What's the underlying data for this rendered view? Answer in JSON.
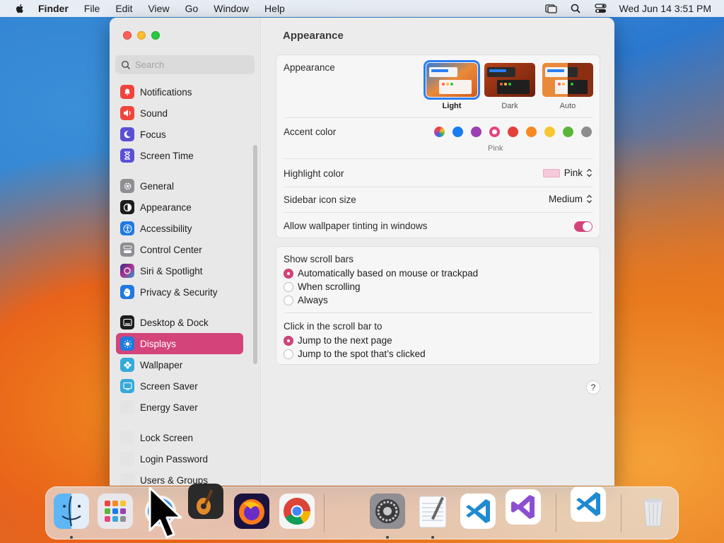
{
  "menubar": {
    "app_name": "Finder",
    "items": [
      "File",
      "Edit",
      "View",
      "Go",
      "Window",
      "Help"
    ],
    "clock": "Wed Jun 14  3:51 PM"
  },
  "window": {
    "search_placeholder": "Search",
    "sidebar": {
      "items": [
        {
          "label": "Notifications",
          "icon": "bell-icon",
          "color": "#f0443c"
        },
        {
          "label": "Sound",
          "icon": "speaker-icon",
          "color": "#f0443c"
        },
        {
          "label": "Focus",
          "icon": "moon-icon",
          "color": "#5b4fd6"
        },
        {
          "label": "Screen Time",
          "icon": "hourglass-icon",
          "color": "#5b4fd6"
        },
        {
          "label": "General",
          "icon": "gear-icon",
          "color": "#8e8e93"
        },
        {
          "label": "Appearance",
          "icon": "appearance-icon",
          "color": "#1d1d1f"
        },
        {
          "label": "Accessibility",
          "icon": "accessibility-icon",
          "color": "#1f7ae0"
        },
        {
          "label": "Control Center",
          "icon": "control-center-icon",
          "color": "#8e8e93"
        },
        {
          "label": "Siri & Spotlight",
          "icon": "siri-icon",
          "color": "#b0308f"
        },
        {
          "label": "Privacy & Security",
          "icon": "hand-icon",
          "color": "#1f7ae0"
        },
        {
          "label": "Desktop & Dock",
          "icon": "desktop-dock-icon",
          "color": "#1d1d1f"
        },
        {
          "label": "Displays",
          "icon": "sun-icon",
          "color": "#1f7ae0"
        },
        {
          "label": "Wallpaper",
          "icon": "wallpaper-icon",
          "color": "#34aadc"
        },
        {
          "label": "Screen Saver",
          "icon": "screen-saver-icon",
          "color": "#34aadc"
        },
        {
          "label": "Energy Saver",
          "icon": "energy-saver-icon",
          "color": "#e4e4e4"
        },
        {
          "label": "Lock Screen",
          "icon": "lock-screen-icon",
          "color": "#e4e4e4"
        },
        {
          "label": "Login Password",
          "icon": "login-password-icon",
          "color": "#e4e4e4"
        },
        {
          "label": "Users & Groups",
          "icon": "users-groups-icon",
          "color": "#e4e4e4"
        }
      ],
      "selected": "Displays"
    },
    "pane": {
      "title": "Appearance",
      "appearance": {
        "label": "Appearance",
        "options": [
          "Light",
          "Dark",
          "Auto"
        ],
        "selected": "Light"
      },
      "accent": {
        "label": "Accent color",
        "colors": [
          "multicolor",
          "#1a7bf2",
          "#9b3fb4",
          "#e8417d",
          "#e3403b",
          "#f58a24",
          "#f7c630",
          "#5ab639",
          "#8d8d8d"
        ],
        "selected_index": 3,
        "selected_name": "Pink"
      },
      "highlight": {
        "label": "Highlight color",
        "value": "Pink"
      },
      "sidebar_icon_size": {
        "label": "Sidebar icon size",
        "value": "Medium"
      },
      "wallpaper_tinting": {
        "label": "Allow wallpaper tinting in windows",
        "on": true
      },
      "scroll_bars": {
        "label": "Show scroll bars",
        "options": [
          "Automatically based on mouse or trackpad",
          "When scrolling",
          "Always"
        ],
        "selected_index": 0
      },
      "click_scroll": {
        "label": "Click in the scroll bar to",
        "options": [
          "Jump to the next page",
          "Jump to the spot that’s clicked"
        ],
        "selected_index": 0
      },
      "help": "?"
    }
  },
  "dock": {
    "apps": [
      "finder-icon",
      "launchpad-icon",
      "safari-icon",
      "garageband-icon",
      "firefox-icon",
      "chrome-icon",
      "system-settings-icon",
      "textedit-icon",
      "vscode-icon",
      "visual-studio-icon",
      "vscode-insiders-icon",
      "trash-icon"
    ]
  },
  "colors": {
    "accent": "#d3447b"
  }
}
